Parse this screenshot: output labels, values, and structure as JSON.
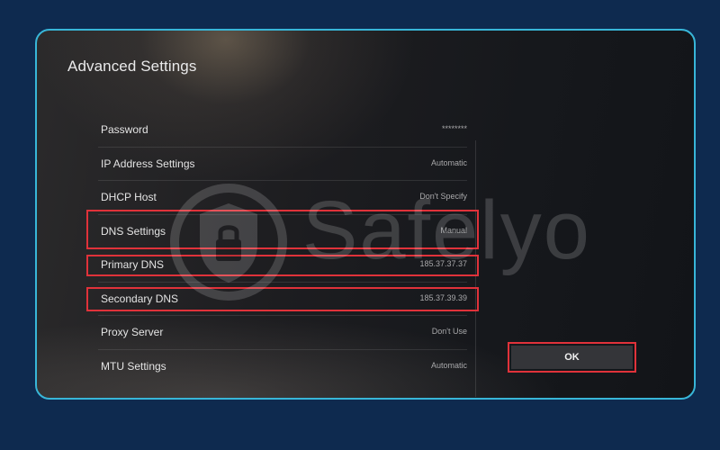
{
  "dialog": {
    "title": "Advanced Settings",
    "items": [
      {
        "label": "Password",
        "value": "********"
      },
      {
        "label": "IP Address Settings",
        "value": "Automatic"
      },
      {
        "label": "DHCP Host",
        "value": "Don't Specify"
      },
      {
        "label": "DNS Settings",
        "value": "Manual"
      },
      {
        "label": "Primary DNS",
        "value": "185.37.37.37"
      },
      {
        "label": "Secondary DNS",
        "value": "185.37.39.39"
      },
      {
        "label": "Proxy Server",
        "value": "Don't Use"
      },
      {
        "label": "MTU Settings",
        "value": "Automatic"
      }
    ],
    "ok_label": "OK"
  },
  "watermark": {
    "text": "Safelyo",
    "icon": "shield-lock-icon"
  },
  "colors": {
    "page_background": "#0e2a4f",
    "panel_border": "#38b6d8",
    "highlight": "#e0323a",
    "button_background": "#343539"
  }
}
